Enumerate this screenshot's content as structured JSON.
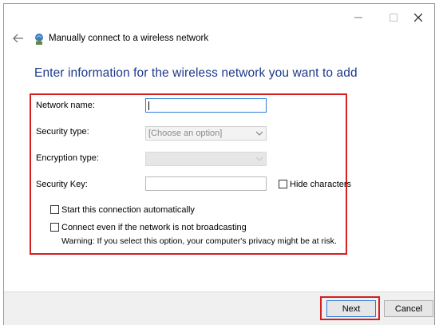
{
  "window": {
    "title": "Manually connect to a wireless network",
    "heading": "Enter information for the wireless network you want to add"
  },
  "icons": {
    "back": "back-arrow-icon",
    "network": "wireless-network-icon",
    "minimize": "minimize-icon",
    "maximize": "maximize-icon",
    "close": "close-icon"
  },
  "form": {
    "network_name": {
      "label": "Network name:",
      "value": ""
    },
    "security_type": {
      "label": "Security type:",
      "value": "[Choose an option]"
    },
    "encryption_type": {
      "label": "Encryption type:",
      "value": ""
    },
    "security_key": {
      "label": "Security Key:",
      "value": ""
    },
    "hide_characters": {
      "label": "Hide characters",
      "checked": false
    },
    "start_automatically": {
      "label": "Start this connection automatically",
      "checked": false
    },
    "connect_not_broadcasting": {
      "label": "Connect even if the network is not broadcasting",
      "checked": false
    },
    "warning": "Warning: If you select this option, your computer's privacy might be at risk."
  },
  "buttons": {
    "next": "Next",
    "cancel": "Cancel"
  },
  "colors": {
    "heading": "#1e3a8a",
    "highlight": "#d42020",
    "focus": "#2f7bd8"
  }
}
